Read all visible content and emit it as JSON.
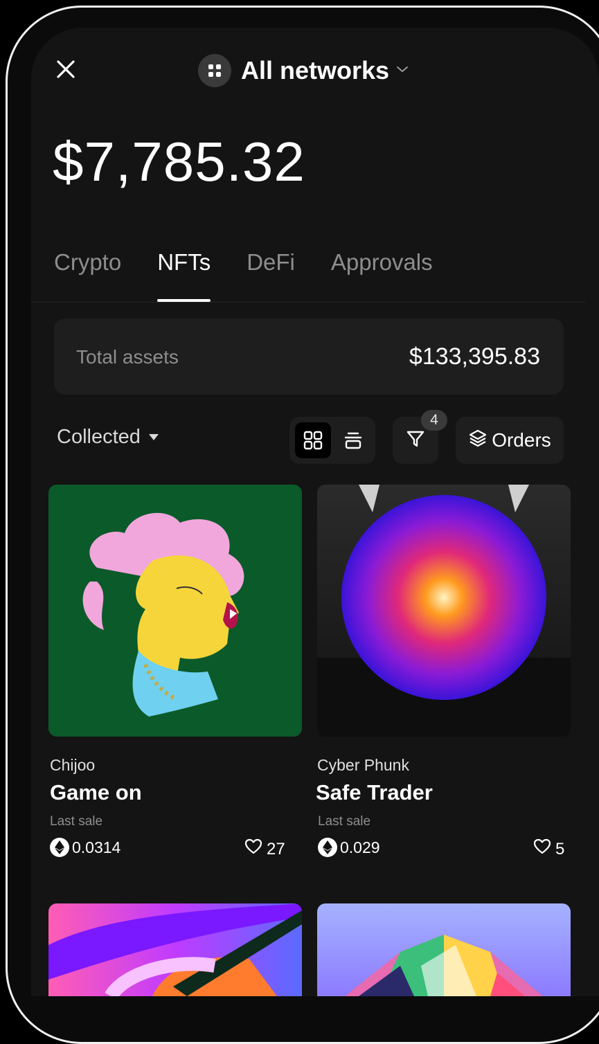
{
  "header": {
    "network_label": "All networks",
    "balance": "$7,785.32"
  },
  "tabs": [
    {
      "label": "Crypto",
      "active": false
    },
    {
      "label": "NFTs",
      "active": true
    },
    {
      "label": "DeFi",
      "active": false
    },
    {
      "label": "Approvals",
      "active": false
    }
  ],
  "total_assets": {
    "label": "Total assets",
    "value": "$133,395.83"
  },
  "toolbar": {
    "collected_label": "Collected",
    "filter_count": "4",
    "orders_label": "Orders"
  },
  "nfts": [
    {
      "collection": "Chijoo",
      "name": "Game on",
      "last_sale_label": "Last sale",
      "price": "0.0314",
      "likes": "27"
    },
    {
      "collection": "Cyber Phunk",
      "name": "Safe Trader",
      "last_sale_label": "Last sale",
      "price": "0.029",
      "likes": "5"
    }
  ],
  "colors": {
    "background": "#141414",
    "card": "#1e1e1e",
    "muted_text": "#8e8e8e",
    "nft1_bg": "#0b5a2a"
  },
  "icons": [
    "close-icon",
    "network-grid-icon",
    "chevron-down-icon",
    "grid-view-icon",
    "list-view-icon",
    "filter-icon",
    "orders-icon",
    "eth-icon",
    "heart-icon"
  ]
}
